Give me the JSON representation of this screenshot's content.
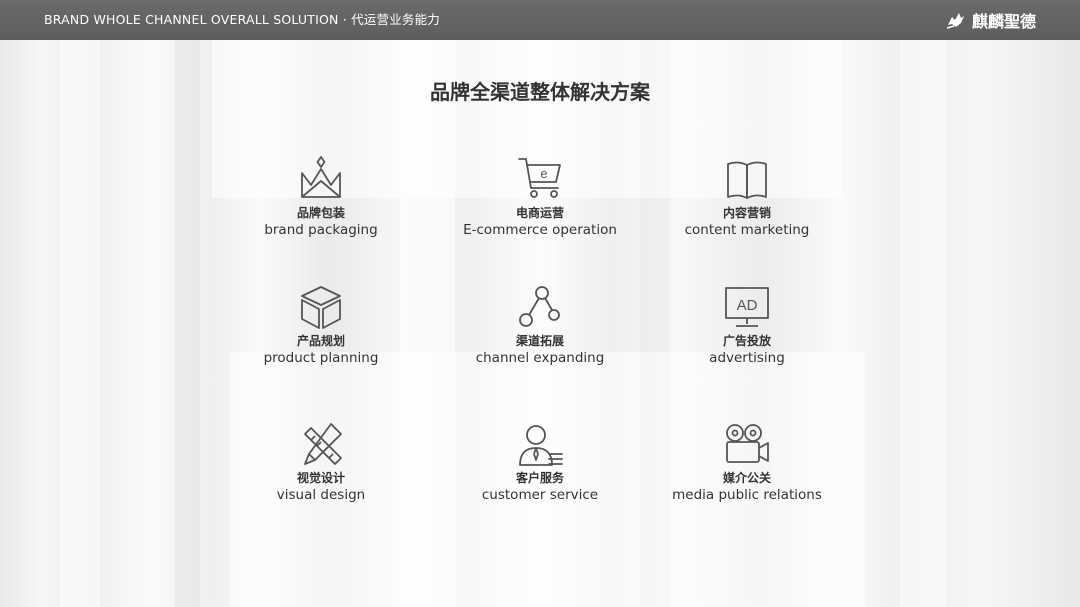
{
  "header": {
    "tagline": "BRAND  WHOLE  CHANNEL  OVERALL  SOLUTION · 代运营业务能力",
    "brand_name": "麒麟聖德"
  },
  "page_title": "品牌全渠道整体解决方案",
  "services": [
    {
      "cn": "品牌包装",
      "en": "brand packaging",
      "icon": "crown-icon"
    },
    {
      "cn": "电商运营",
      "en": "E-commerce operation",
      "icon": "shopping-cart-icon"
    },
    {
      "cn": "内容营销",
      "en": "content marketing",
      "icon": "open-book-icon"
    },
    {
      "cn": "产品规划",
      "en": "product planning",
      "icon": "box-icon"
    },
    {
      "cn": "渠道拓展",
      "en": "channel expanding",
      "icon": "network-nodes-icon"
    },
    {
      "cn": "广告投放",
      "en": "advertising",
      "icon": "ad-screen-icon"
    },
    {
      "cn": "视觉设计",
      "en": "visual design",
      "icon": "pencil-ruler-icon"
    },
    {
      "cn": "客户服务",
      "en": "customer service",
      "icon": "service-person-icon"
    },
    {
      "cn": "媒介公关",
      "en": "media public relations",
      "icon": "video-camera-icon"
    }
  ],
  "icon_labels": {
    "ad": "AD",
    "cart": "e"
  },
  "colors": {
    "header_bg": "#606060",
    "icon_stroke": "#555555",
    "text": "#333333"
  }
}
